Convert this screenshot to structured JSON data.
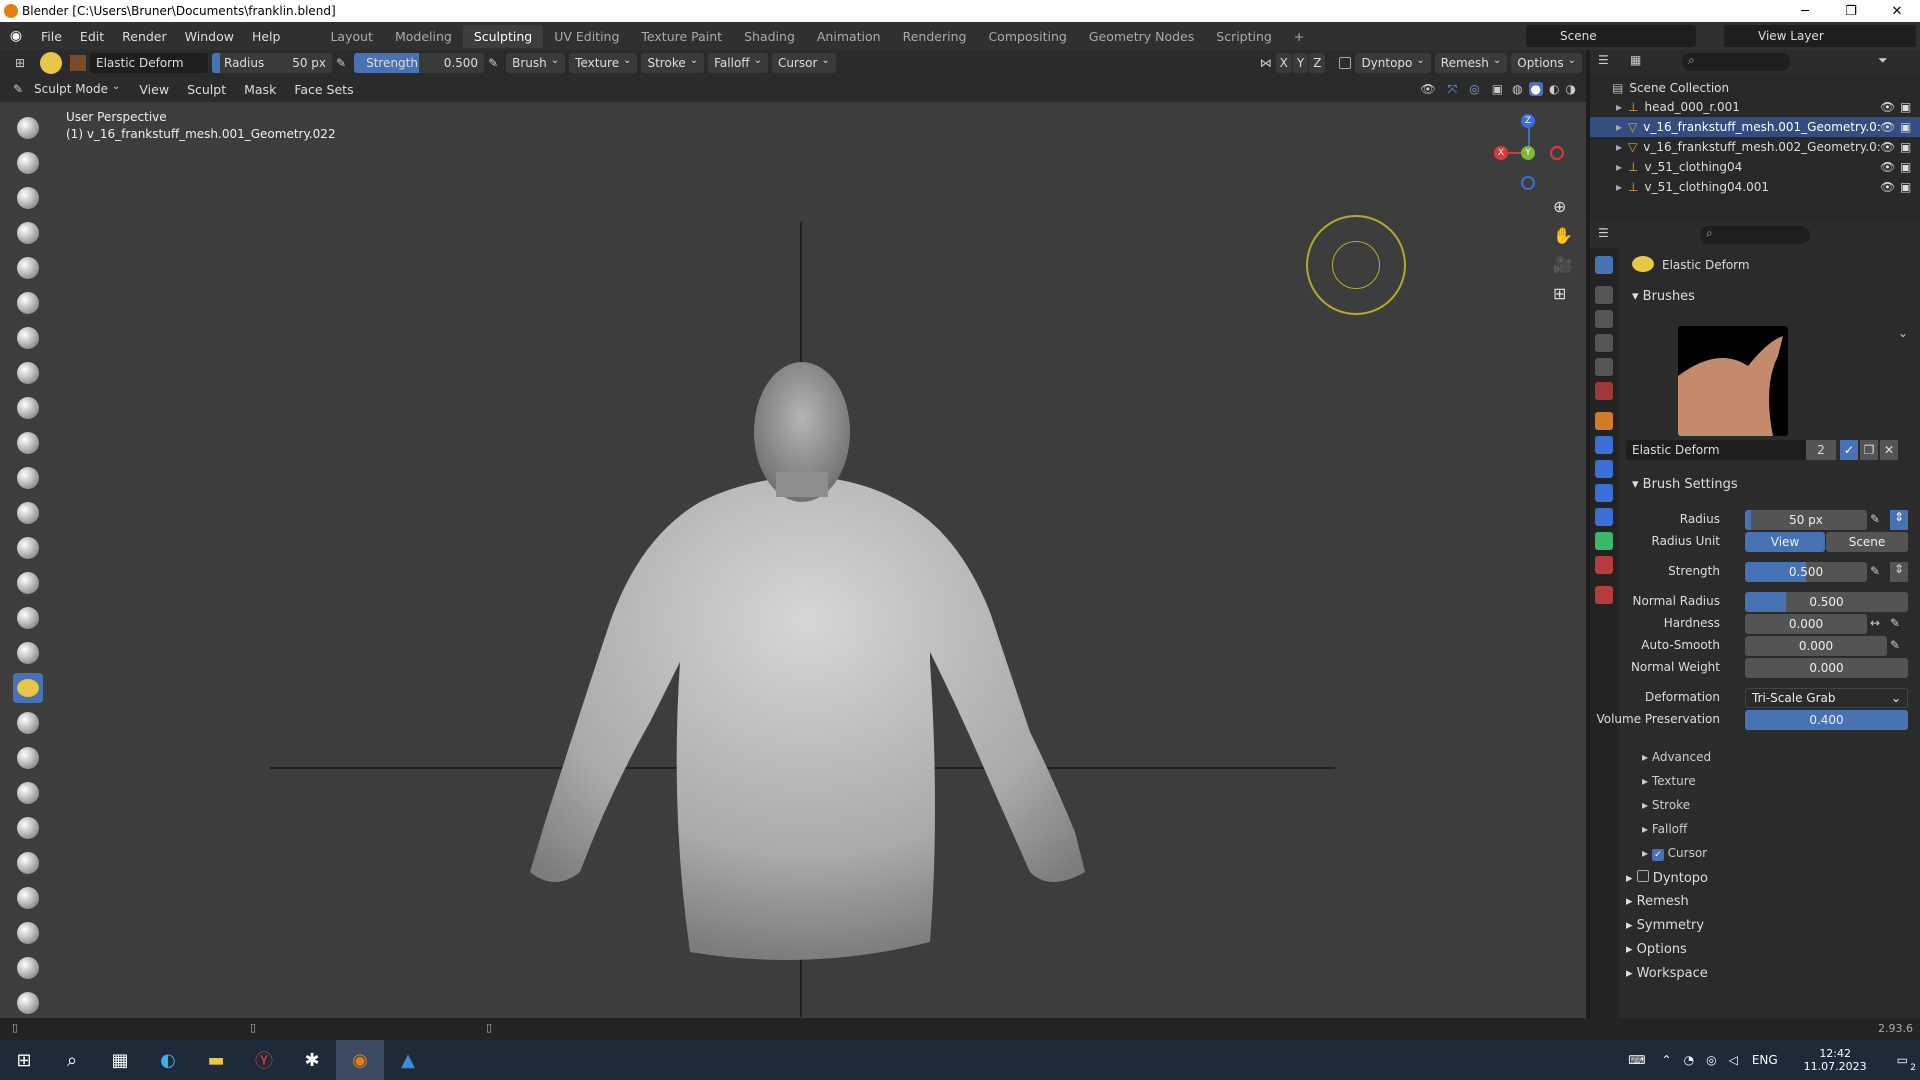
{
  "window": {
    "title": "Blender [C:\\Users\\Bruner\\Documents\\franklin.blend]"
  },
  "menu": [
    "File",
    "Edit",
    "Render",
    "Window",
    "Help"
  ],
  "workspaces": [
    "Layout",
    "Modeling",
    "Sculpting",
    "UV Editing",
    "Texture Paint",
    "Shading",
    "Animation",
    "Rendering",
    "Compositing",
    "Geometry Nodes",
    "Scripting"
  ],
  "active_workspace": "Sculpting",
  "scene": {
    "name": "Scene",
    "view_layer": "View Layer"
  },
  "header": {
    "brush_name": "Elastic Deform",
    "radius_label": "Radius",
    "radius_value": "50 px",
    "strength_label": "Strength",
    "strength_value": "0.500",
    "brush": "Brush",
    "texture": "Texture",
    "stroke": "Stroke",
    "falloff": "Falloff",
    "cursor": "Cursor",
    "axes": [
      "X",
      "Y",
      "Z"
    ],
    "dyntopo": "Dyntopo",
    "remesh": "Remesh",
    "options": "Options"
  },
  "viewport_header": {
    "mode": "Sculpt Mode",
    "menus": [
      "View",
      "Sculpt",
      "Mask",
      "Face Sets"
    ]
  },
  "viewport": {
    "perspective": "User Perspective",
    "object": "(1) v_16_frankstuff_mesh.001_Geometry.022"
  },
  "gizmo": {
    "x": "X",
    "y": "Y",
    "z": "Z"
  },
  "outliner": {
    "root": "Scene Collection",
    "items": [
      {
        "name": "head_000_r.001",
        "selected": false
      },
      {
        "name": "v_16_frankstuff_mesh.001_Geometry.0:",
        "selected": true
      },
      {
        "name": "v_16_frankstuff_mesh.002_Geometry.0:",
        "selected": false
      },
      {
        "name": "v_51_clothing04",
        "selected": false
      },
      {
        "name": "v_51_clothing04.001",
        "selected": false
      }
    ]
  },
  "properties": {
    "brush_title": "Elastic Deform",
    "brushes_section": "Brushes",
    "brush_name": "Elastic Deform",
    "brush_users": "2",
    "brush_settings_section": "Brush Settings",
    "radius": {
      "label": "Radius",
      "value": "50 px",
      "fraction": 0.05
    },
    "radius_unit": {
      "label": "Radius Unit",
      "options": [
        "View",
        "Scene"
      ],
      "selected": "View"
    },
    "strength": {
      "label": "Strength",
      "value": "0.500",
      "fraction": 0.5
    },
    "normal_radius": {
      "label": "Normal Radius",
      "value": "0.500",
      "fraction": 0.25
    },
    "hardness": {
      "label": "Hardness",
      "value": "0.000"
    },
    "auto_smooth": {
      "label": "Auto-Smooth",
      "value": "0.000"
    },
    "normal_weight": {
      "label": "Normal Weight",
      "value": "0.000"
    },
    "deformation": {
      "label": "Deformation",
      "value": "Tri-Scale Grab"
    },
    "volume_preservation": {
      "label": "Volume Preservation",
      "value": "0.400",
      "fraction": 1.0
    },
    "subsections": [
      "Advanced",
      "Texture",
      "Stroke",
      "Falloff",
      "Cursor"
    ],
    "cursor_checked": true,
    "sections": [
      "Dyntopo",
      "Remesh",
      "Symmetry",
      "Options",
      "Workspace"
    ]
  },
  "status": {
    "version": "2.93.6"
  },
  "taskbar": {
    "lang": "ENG",
    "time": "12:42",
    "date": "11.07.2023",
    "notif": "2"
  }
}
